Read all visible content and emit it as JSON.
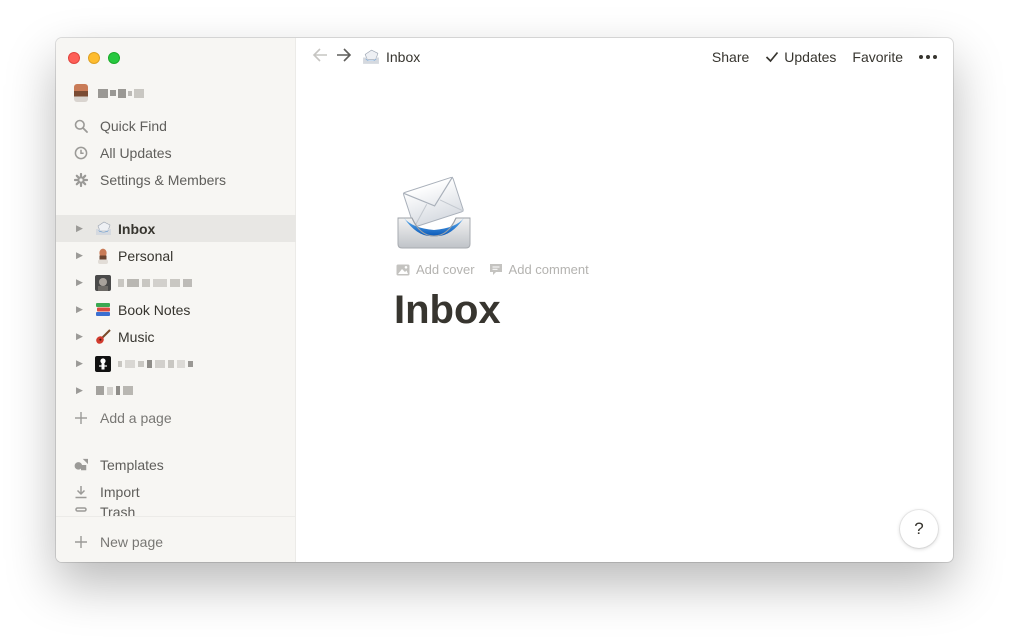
{
  "sidebar": {
    "nav": [
      {
        "label": "Quick Find",
        "icon": "search-icon"
      },
      {
        "label": "All Updates",
        "icon": "clock-icon"
      },
      {
        "label": "Settings & Members",
        "icon": "gear-icon"
      }
    ],
    "pages": [
      {
        "label": "Inbox",
        "icon": "inbox-tray-icon",
        "active": true
      },
      {
        "label": "Personal",
        "icon": "person-avatar-icon"
      },
      {
        "label": "",
        "icon": "photo-avatar-icon",
        "redacted": true
      },
      {
        "label": "Book Notes",
        "icon": "books-icon"
      },
      {
        "label": "Music",
        "icon": "guitar-icon"
      },
      {
        "label": "",
        "icon": "skeleton-icon",
        "redacted": true
      },
      {
        "label": "",
        "icon": "",
        "redacted": true
      }
    ],
    "add_page": "Add a page",
    "tools": [
      {
        "label": "Templates",
        "icon": "shapes-icon"
      },
      {
        "label": "Import",
        "icon": "download-icon"
      },
      {
        "label": "Trash",
        "icon": "trash-icon"
      }
    ],
    "new_page": "New page"
  },
  "topbar": {
    "breadcrumb": "Inbox",
    "share": "Share",
    "updates": "Updates",
    "favorite": "Favorite"
  },
  "page": {
    "add_cover": "Add cover",
    "add_comment": "Add comment",
    "title": "Inbox"
  },
  "help": "?"
}
